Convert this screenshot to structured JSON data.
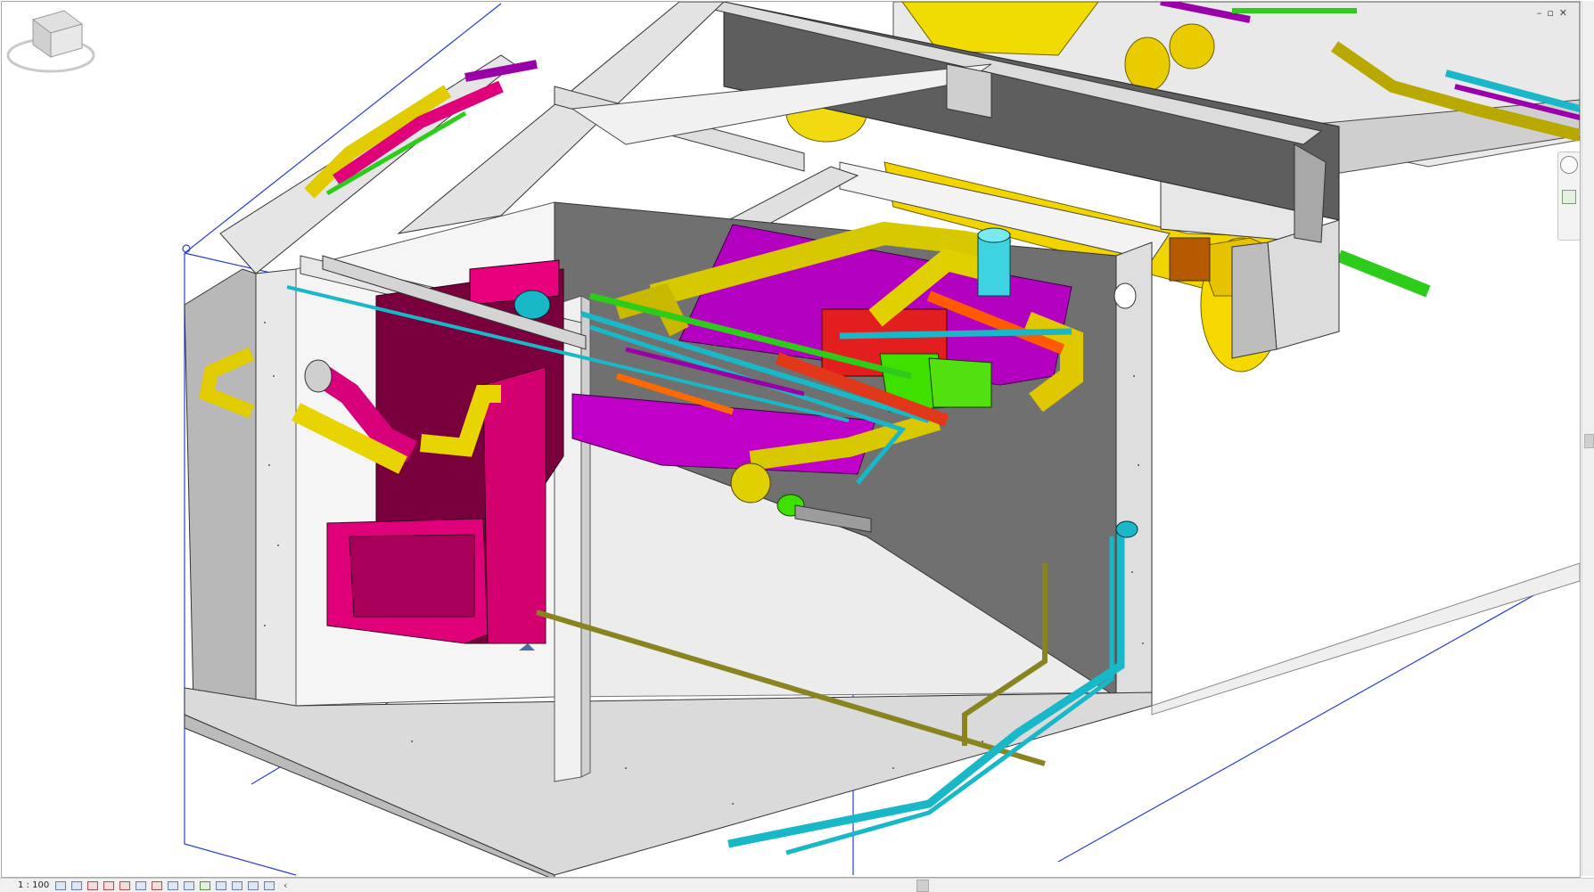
{
  "window": {
    "minimize": "–",
    "restore": "▫",
    "close": "✕"
  },
  "statusbar": {
    "scale": "1 : 100",
    "view_controls": [
      "detail-level-icon",
      "visual-style-icon",
      "sun-path-icon",
      "shadows-icon",
      "crop-region-icon",
      "show-crop-icon",
      "3d-lock-icon",
      "temporary-hide-icon",
      "reveal-hidden-icon",
      "worksharing-icon",
      "analytical-model-icon",
      "highlight-displacement-icon",
      "constraints-icon",
      "design-options-icon"
    ],
    "scroll_left": "‹"
  },
  "colors": {
    "concrete": "#d9d9d9",
    "concrete_dark": "#8a8a8a",
    "wall_shade": "#6e6e6e",
    "duct_yellow": "#e8d400",
    "duct_magenta": "#e0007a",
    "pipe_cyan": "#18b8c8",
    "pipe_green": "#2ecc1a",
    "pipe_red": "#e2381a",
    "pipe_purple": "#9a00a8",
    "pipe_orange": "#ff6a00",
    "pipe_olive": "#8a8420",
    "section_box": "#2a3fd6"
  }
}
